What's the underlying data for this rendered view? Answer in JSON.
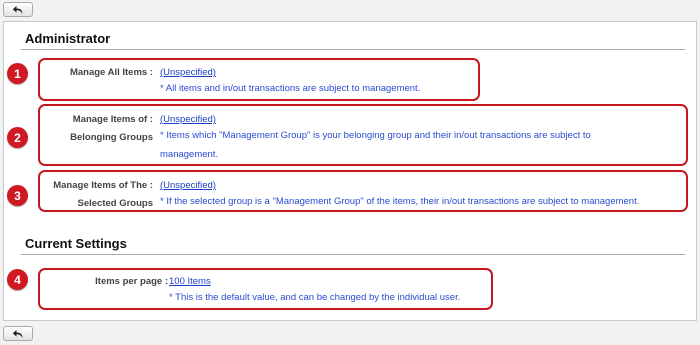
{
  "nav": {
    "back_icon": "back-arrow-icon"
  },
  "sections": {
    "administrator": {
      "title": "Administrator"
    },
    "current_settings": {
      "title": "Current Settings"
    }
  },
  "settings": [
    {
      "badge": "1",
      "label": "Manage All Items :",
      "label_lines": [
        "Manage All Items :"
      ],
      "value": "(Unspecified)",
      "description": "* All items and in/out transactions are subject to management."
    },
    {
      "badge": "2",
      "label_lines": [
        "Manage Items of :",
        "Belonging Groups"
      ],
      "value": "(Unspecified)",
      "description": "* Items which \"Management Group\" is your belonging group and their in/out transactions are subject to management."
    },
    {
      "badge": "3",
      "label_lines": [
        "Manage Items of The :",
        "Selected Groups"
      ],
      "value": "(Unspecified)",
      "description": "* If the selected group is a \"Management Group\" of the items, their in/out transactions are subject to management."
    },
    {
      "badge": "4",
      "label_lines": [
        "Items per page :"
      ],
      "value": "100 Items",
      "description": "* This is the default value, and can be changed by the individual user."
    }
  ],
  "colors": {
    "highlight_red": "#c4171f",
    "link_blue": "#1a3fc4",
    "note_blue": "#2a4bd0"
  }
}
